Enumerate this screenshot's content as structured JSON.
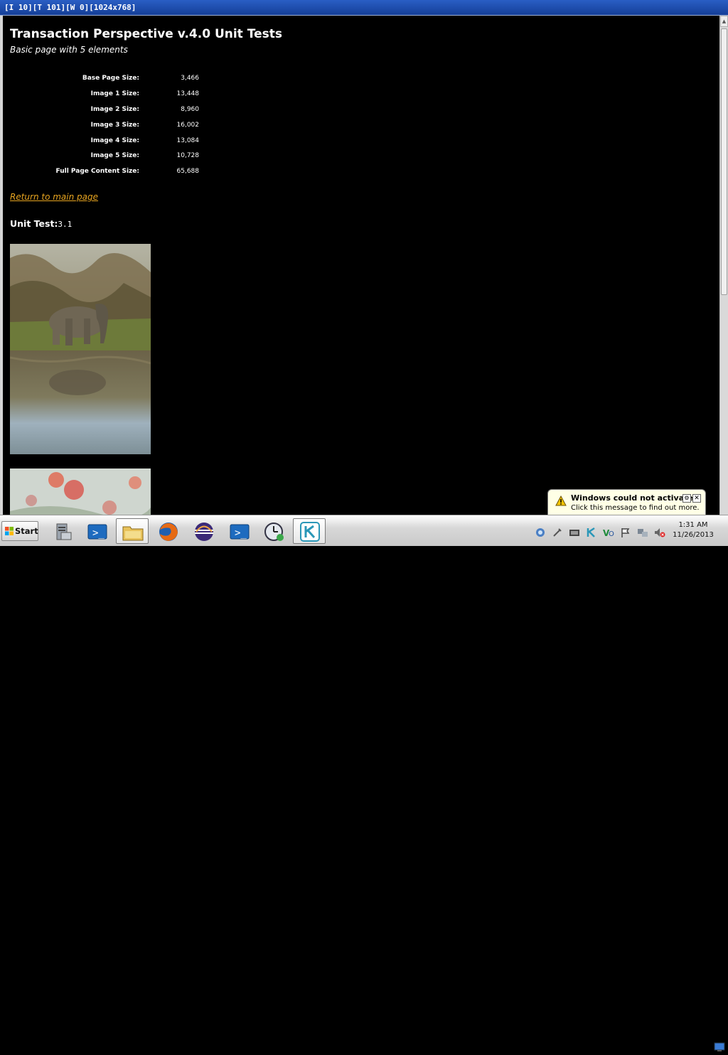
{
  "window": {
    "title": "[I 10][T 101][W 0][1024x768]"
  },
  "page": {
    "heading": "Transaction Perspective v.4.0 Unit Tests",
    "subheading": "Basic page with 5 elements",
    "sizes": [
      {
        "label": "Base Page Size:",
        "value": "3,466"
      },
      {
        "label": "Image 1 Size:",
        "value": "13,448"
      },
      {
        "label": "Image 2 Size:",
        "value": "8,960"
      },
      {
        "label": "Image 3 Size:",
        "value": "16,002"
      },
      {
        "label": "Image 4 Size:",
        "value": "13,084"
      },
      {
        "label": "Image 5 Size:",
        "value": "10,728"
      },
      {
        "label": "Full Page Content Size:",
        "value": "65,688"
      }
    ],
    "return_link": "Return to main page",
    "unit_test_label": "Unit Test:",
    "unit_test_value": "3.1",
    "link_color": "#e8a520"
  },
  "taskbar": {
    "start_label": "Start",
    "apps": [
      {
        "icon": "server-manager-icon"
      },
      {
        "icon": "powershell-icon"
      },
      {
        "icon": "folder-icon"
      },
      {
        "icon": "firefox-icon"
      },
      {
        "icon": "eclipse-icon"
      },
      {
        "icon": "powershell-icon"
      },
      {
        "icon": "clock-app-icon"
      },
      {
        "icon": "k-app-icon"
      }
    ],
    "clock_time": "1:31 AM",
    "clock_date": "11/26/2013"
  },
  "notification": {
    "title": "Windows could not activate",
    "message": "Click this message to find out more."
  }
}
